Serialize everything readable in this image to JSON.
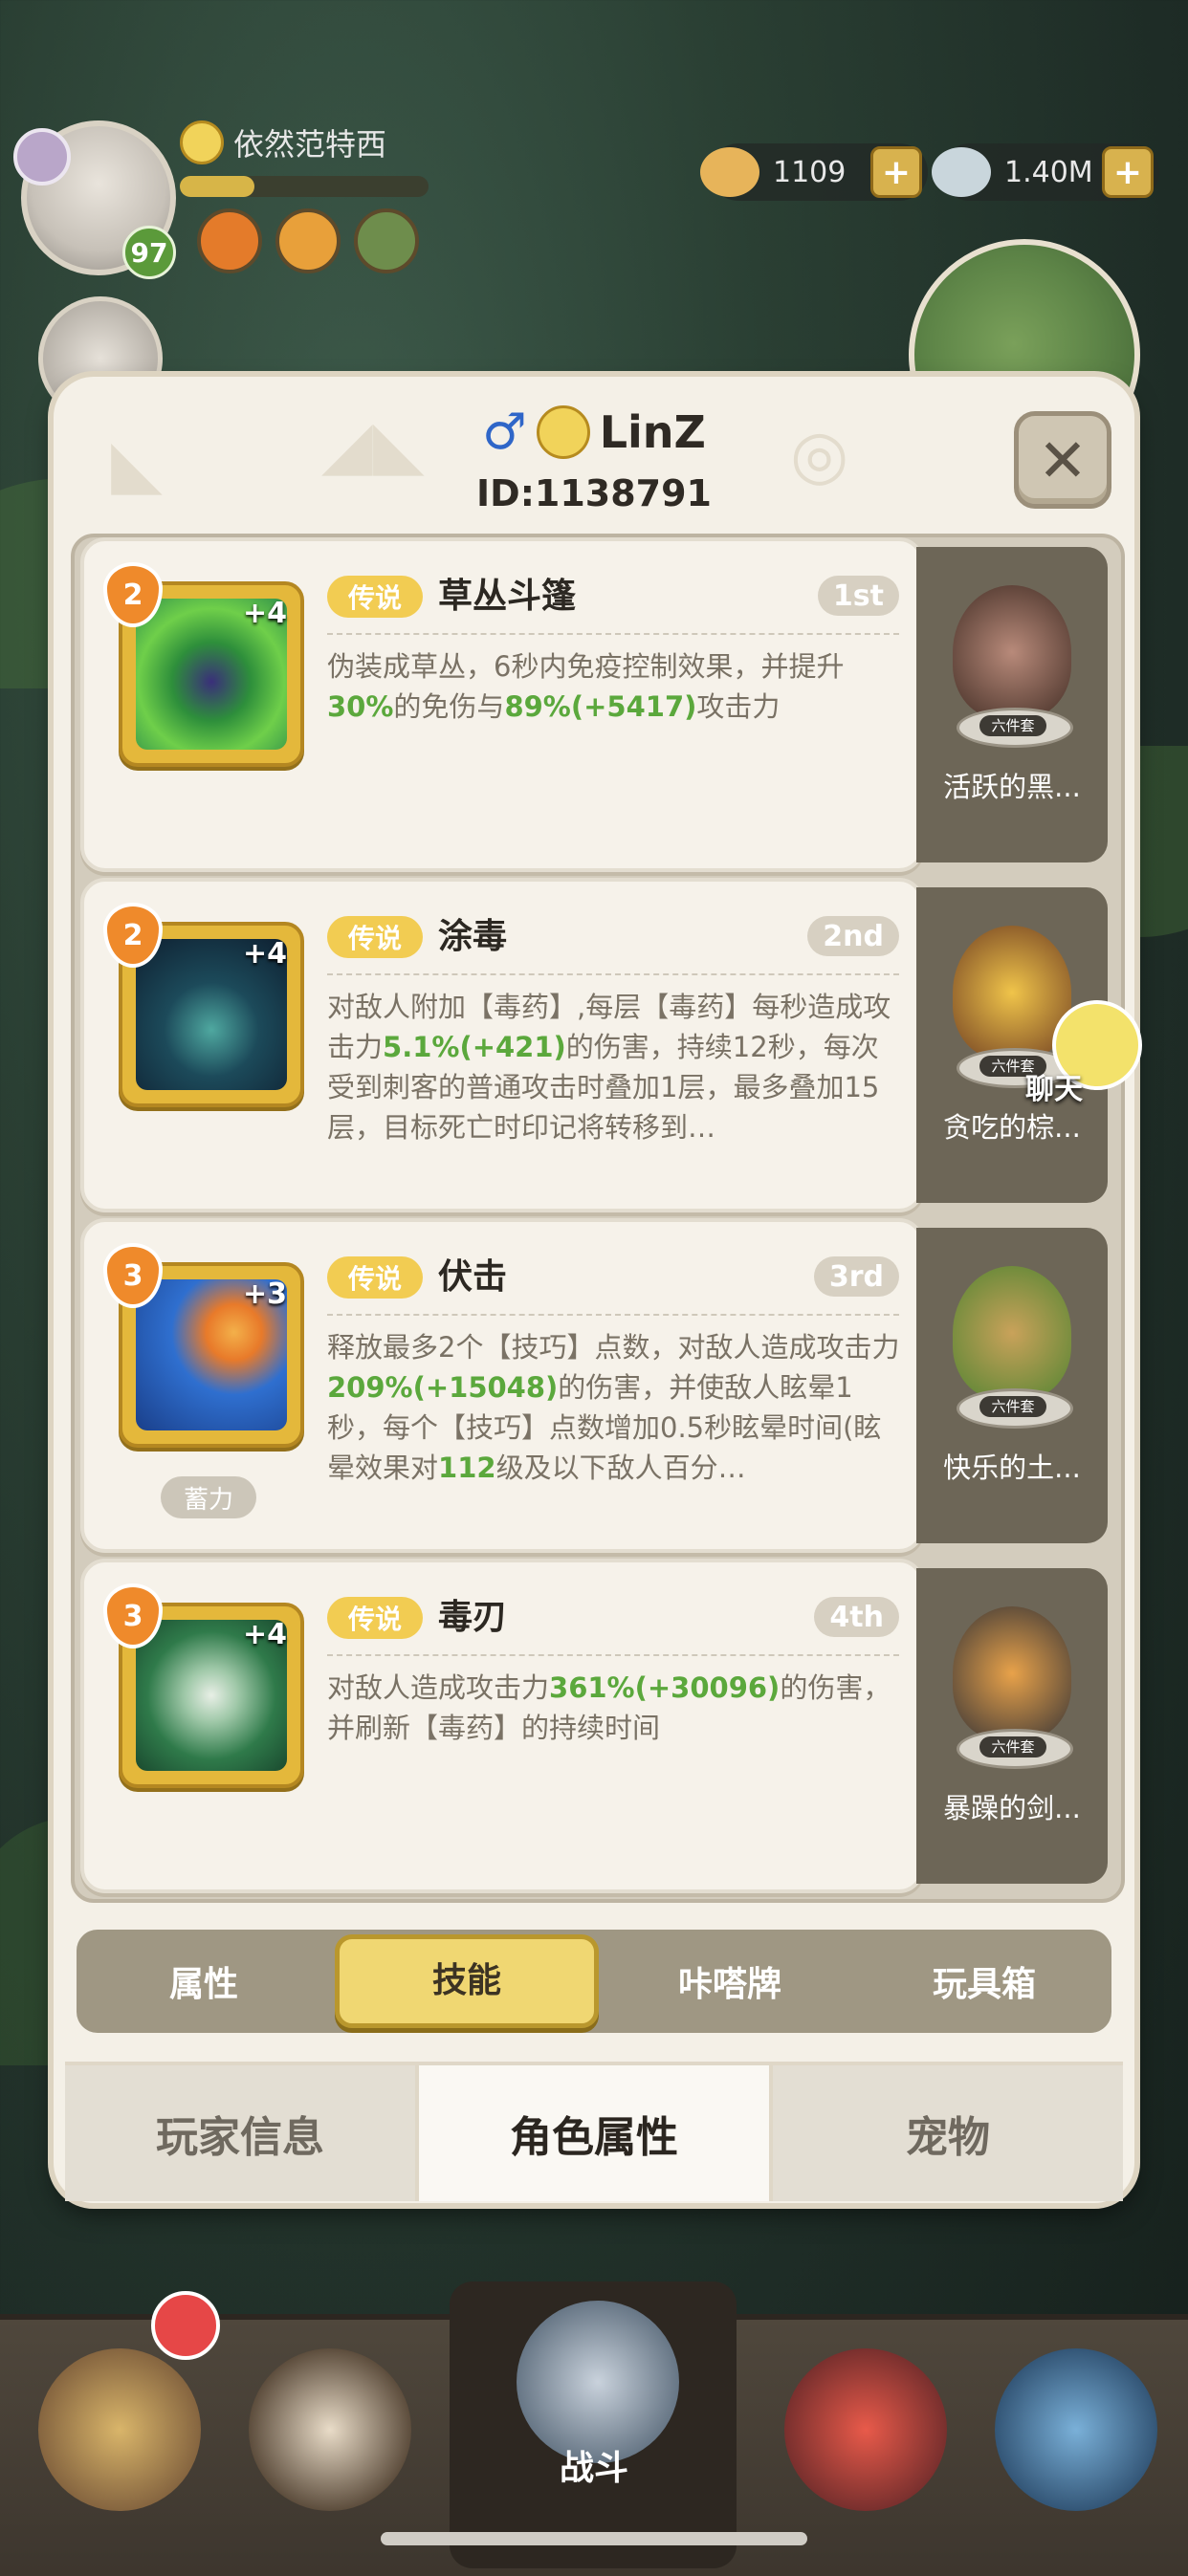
{
  "hud": {
    "player_name": "依然范特西",
    "level": "97",
    "xp_fraction": 0.3,
    "currencies": [
      {
        "icon": "seashell-icon",
        "value": "1109"
      },
      {
        "icon": "pearl-icon",
        "value": "1.40M"
      }
    ]
  },
  "panel": {
    "gender_icon": "male-icon",
    "name": "LinZ",
    "id_text": "ID:1138791",
    "close_label": "✕"
  },
  "skills": [
    {
      "tier": "2",
      "plus": "+4",
      "rarity": "传说",
      "name": "草丛斗篷",
      "rank": "1st",
      "desc_parts": [
        "伪装成草丛，6秒内免疫控制效果，并提升",
        "30%",
        "的免伤与",
        "89%(+5417)",
        "攻击力"
      ],
      "tag": "",
      "side_label": "活跃的黑...",
      "side_tag": "六件套"
    },
    {
      "tier": "2",
      "plus": "+4",
      "rarity": "传说",
      "name": "涂毒",
      "rank": "2nd",
      "desc_parts": [
        "对敌人附加【毒药】,每层【毒药】每秒造成攻击力",
        "5.1%(+421)",
        "的伤害，持续12秒，每次受到刺客的普通攻击时叠加1层，最多叠加15层，目标死亡时印记将转移到…"
      ],
      "tag": "",
      "side_label": "贪吃的棕...",
      "side_tag": "六件套"
    },
    {
      "tier": "3",
      "plus": "+3",
      "rarity": "传说",
      "name": "伏击",
      "rank": "3rd",
      "desc_parts": [
        "释放最多2个【技巧】点数，对敌人造成攻击力",
        "209%(+15048)",
        "的伤害，并使敌人眩晕1秒，每个【技巧】点数增加0.5秒眩晕时间(眩晕效果对",
        "112",
        "级及以下敌人百分…"
      ],
      "tag": "蓄力",
      "side_label": "快乐的土...",
      "side_tag": "六件套"
    },
    {
      "tier": "3",
      "plus": "+4",
      "rarity": "传说",
      "name": "毒刃",
      "rank": "4th",
      "desc_parts": [
        "对敌人造成攻击力",
        "361%(+30096)",
        "的伤害，并刷新【毒药】的持续时间"
      ],
      "tag": "",
      "side_label": "暴躁的剑...",
      "side_tag": "六件套"
    }
  ],
  "sub_tabs": [
    "属性",
    "技能",
    "咔嗒牌",
    "玩具箱"
  ],
  "main_tabs": [
    "玩家信息",
    "角色属性",
    "宠物"
  ],
  "chat_label": "聊天",
  "nav": {
    "battle_label": "战斗"
  },
  "colors": {
    "highlight_green": "#5ba83c",
    "rarity_gold": "#f2cc52",
    "active_tab": "#f0d772",
    "tier_orange": "#ef8a2b"
  }
}
